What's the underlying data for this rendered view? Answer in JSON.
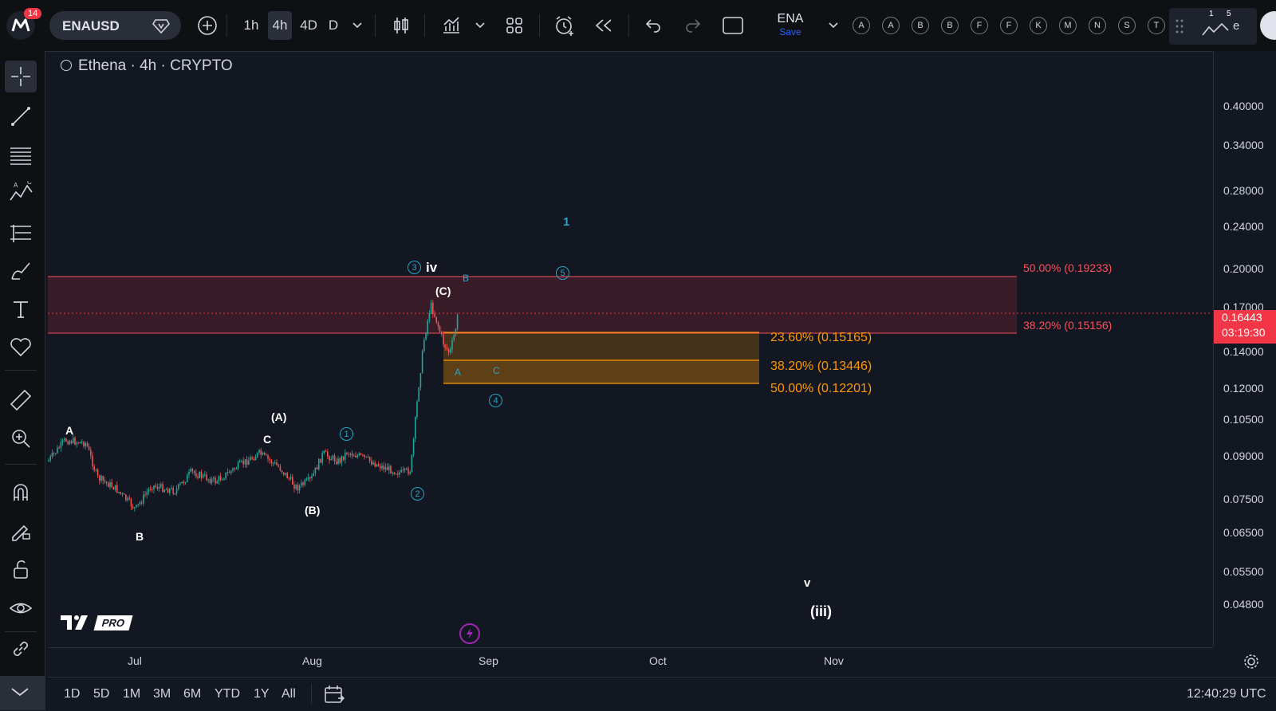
{
  "top": {
    "notification_count": "14",
    "symbol": "ENAUSD",
    "timeframes": [
      "1h",
      "4h",
      "4D",
      "D"
    ],
    "active_timeframe": "4h",
    "layout_name": "ENA",
    "save_label": "Save",
    "alert_letters": [
      "A",
      "A",
      "B",
      "B",
      "F",
      "F",
      "K",
      "M",
      "N",
      "S",
      "T"
    ],
    "small_nums": [
      "1",
      "5"
    ],
    "trailing_letter": "e"
  },
  "legend": {
    "text": "Ethena · 4h · CRYPTO"
  },
  "price_axis": {
    "labels": [
      "0.40000",
      "0.34000",
      "0.28000",
      "0.24000",
      "0.20000",
      "0.17000",
      "0.14000",
      "0.12000",
      "0.10500",
      "0.09000",
      "0.07500",
      "0.06500",
      "0.05500",
      "0.04800"
    ],
    "current_price": "0.16443",
    "countdown": "03:19:30",
    "current_price_color": "#f23645",
    "scale": "log"
  },
  "time_axis": {
    "labels": [
      "Jul",
      "Aug",
      "Sep",
      "Oct",
      "Nov"
    ]
  },
  "fib_upper": {
    "level_a": "50.00% (0.19233)",
    "level_b": "38.20% (0.15156)",
    "color": "#f7525f"
  },
  "fib_lower": {
    "level_a": "23.60% (0.15165)",
    "level_b": "38.20% (0.13446)",
    "level_c": "50.00% (0.12201)",
    "color": "#ff9800"
  },
  "annotations": {
    "white": [
      "A",
      "B",
      "C",
      "(A)",
      "(B)",
      "(C)",
      "iv",
      "v",
      "(iii)"
    ],
    "cyan_letters": [
      "B",
      "A",
      "C"
    ],
    "cyan_circled": [
      "1",
      "2",
      "3",
      "4",
      "5"
    ],
    "cyan_plain": "1"
  },
  "bottom": {
    "ranges": [
      "1D",
      "5D",
      "1M",
      "3M",
      "6M",
      "YTD",
      "1Y",
      "All"
    ],
    "clock": "12:40:29 UTC"
  },
  "branding": {
    "pro_label": "PRO"
  },
  "colors": {
    "background": "#131722",
    "up": "#26a69a",
    "down": "#ef5350",
    "accent": "#2962ff",
    "wave": "#26a5c9"
  }
}
